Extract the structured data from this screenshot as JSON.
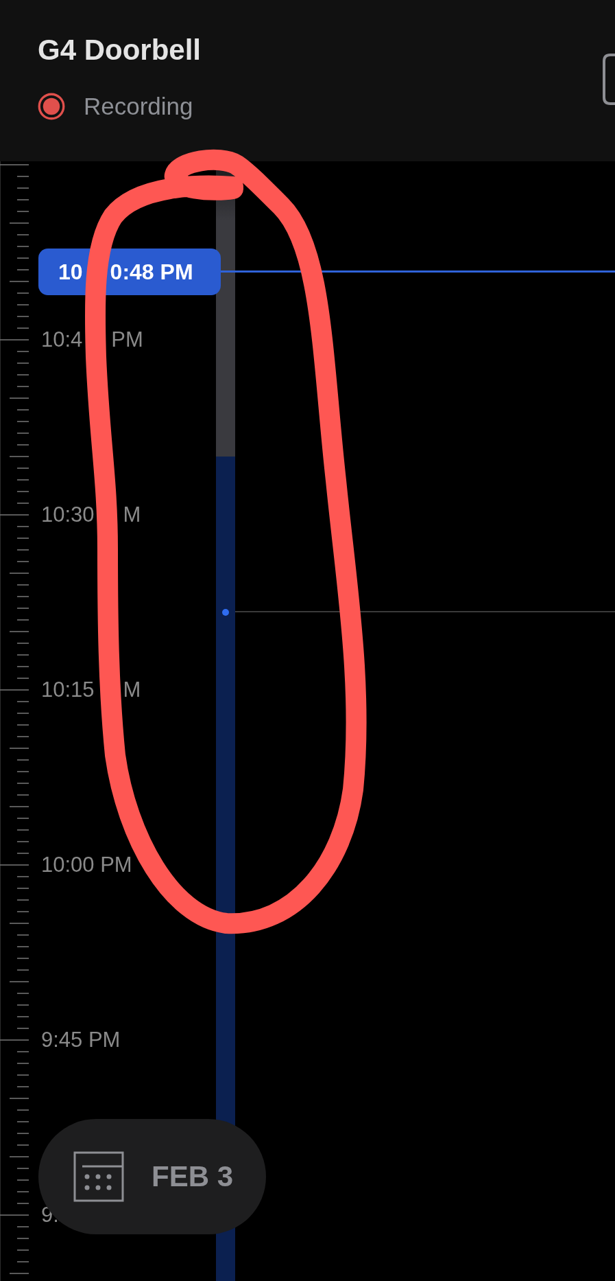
{
  "header": {
    "title": "G4 Doorbell",
    "status": {
      "text": "Recording"
    }
  },
  "timeline": {
    "labels": [
      {
        "text": "10:4",
        "rest": "PM"
      },
      {
        "text": "10:30",
        "rest": "M"
      },
      {
        "text": "10:15",
        "rest": "M"
      },
      {
        "text": "10:00 PM"
      },
      {
        "text": "9:45 PM"
      },
      {
        "text": "9:"
      }
    ],
    "playhead": {
      "text": "10",
      "rest": "0:48 PM"
    }
  },
  "date_button": {
    "label": "FEB 3"
  }
}
